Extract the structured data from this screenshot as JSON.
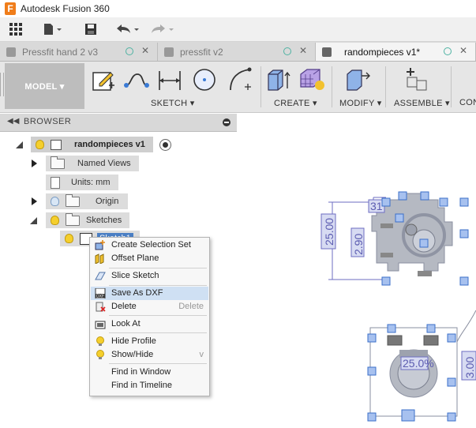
{
  "app": {
    "title": "Autodesk Fusion 360",
    "logo_letter": "F"
  },
  "tabs": [
    {
      "label": "Pressfit hand 2 v3",
      "active": false
    },
    {
      "label": "pressfit v2",
      "active": false
    },
    {
      "label": "randompieces v1*",
      "active": true
    }
  ],
  "toolbar": {
    "workspace": "MODEL ▾",
    "groups": [
      {
        "label": "SKETCH ▾"
      },
      {
        "label": "CREATE ▾"
      },
      {
        "label": "MODIFY ▾"
      },
      {
        "label": "ASSEMBLE ▾"
      },
      {
        "label": "CON"
      }
    ]
  },
  "browser": {
    "title": "BROWSER",
    "root": "randompieces v1",
    "items": [
      {
        "label": "Named Views"
      },
      {
        "label": "Units: mm"
      },
      {
        "label": "Origin"
      },
      {
        "label": "Sketches"
      }
    ],
    "sketch_selected": "Sketch1"
  },
  "context_menu": {
    "items": [
      {
        "label": "Create Selection Set",
        "icon": "selection-set-icon"
      },
      {
        "label": "Offset Plane",
        "icon": "offset-plane-icon"
      },
      {
        "label": "Slice Sketch",
        "icon": "slice-sketch-icon"
      },
      {
        "label": "Save As DXF",
        "icon": "dxf-icon",
        "highlighted": true
      },
      {
        "label": "Delete",
        "icon": "delete-icon",
        "shortcut": "Delete"
      },
      {
        "label": "Look At",
        "icon": "look-at-icon"
      },
      {
        "label": "Hide Profile",
        "icon": "bulb-icon"
      },
      {
        "label": "Show/Hide",
        "icon": "bulb-icon",
        "shortcut": "v"
      },
      {
        "label": "Find in Window"
      },
      {
        "label": "Find in Timeline"
      }
    ]
  },
  "canvas": {
    "dimensions": [
      "25.00",
      "2.90",
      "31",
      "25.0%",
      "3.00"
    ]
  },
  "colors": {
    "accent": "#f07d1a",
    "menu_highlight": "#cfe0f3",
    "sketch_blue": "#5b5bb0",
    "part_gray": "#b5b9c2"
  }
}
